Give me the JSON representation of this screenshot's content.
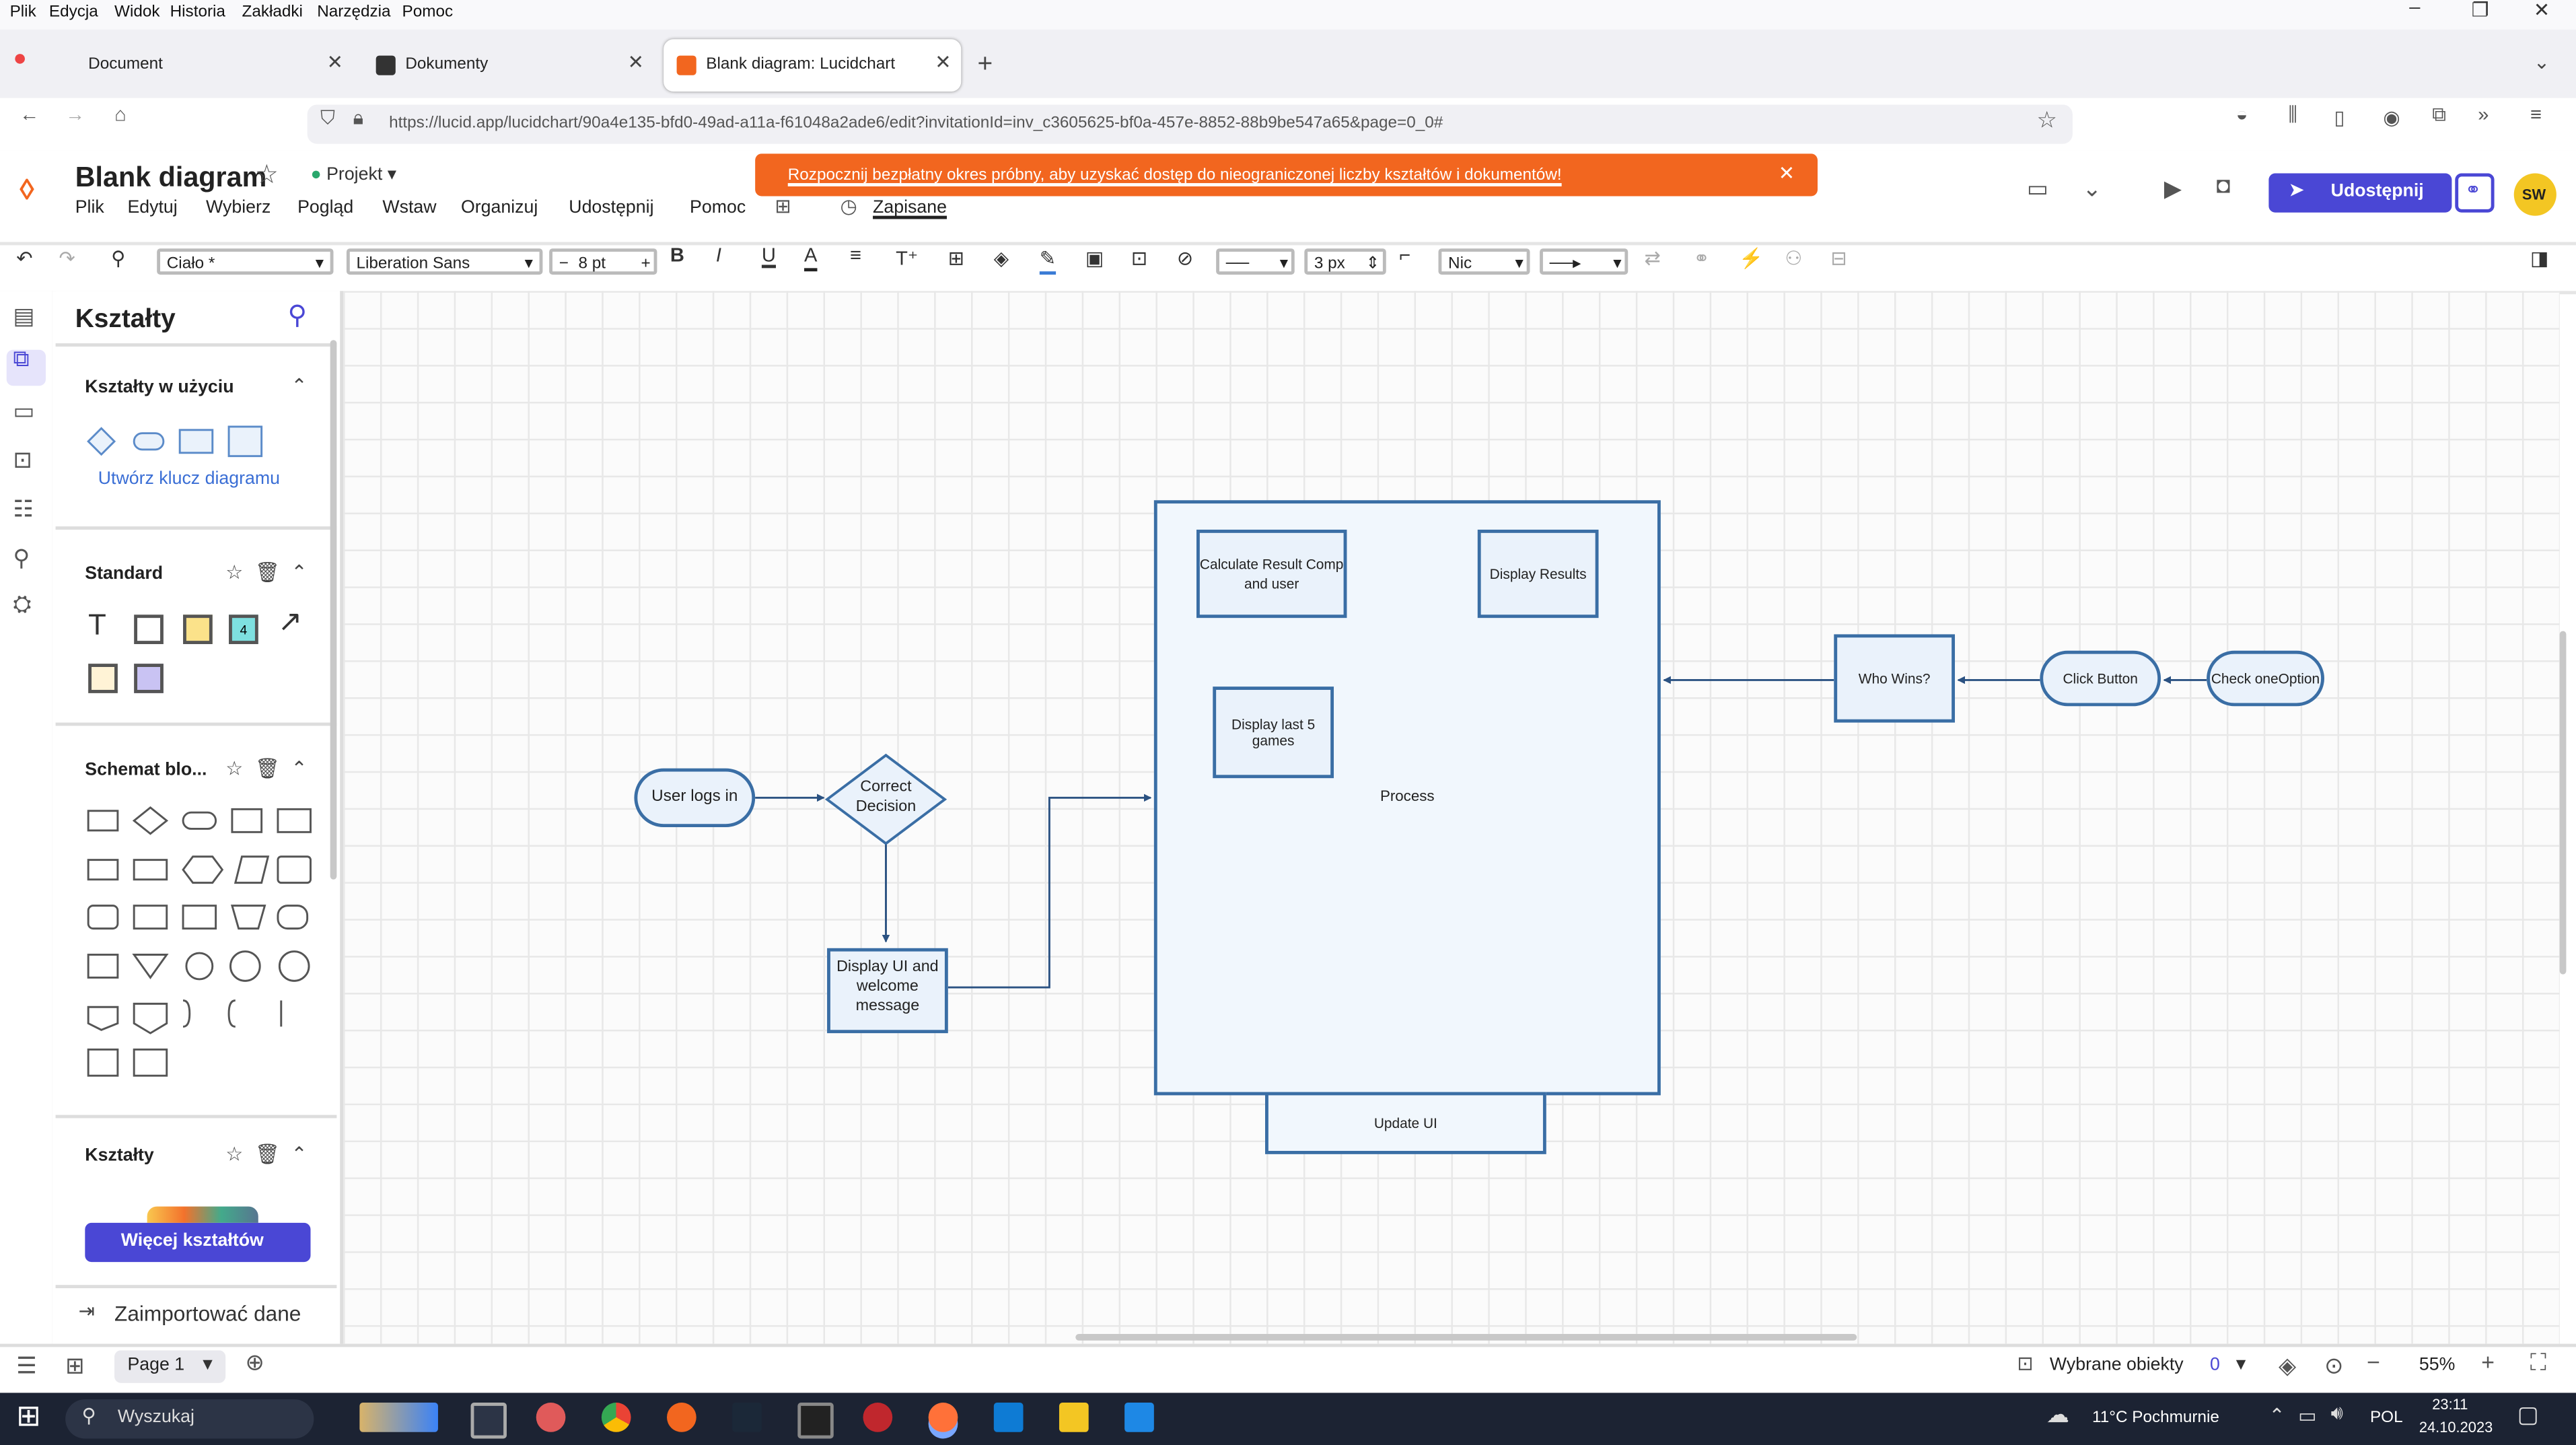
{
  "browser": {
    "menu": [
      "Plik",
      "Edycja",
      "Widok",
      "Historia",
      "Zakładki",
      "Narzędzia",
      "Pomoc"
    ],
    "tabs": [
      {
        "label": "Document"
      },
      {
        "label": "Dokumenty"
      },
      {
        "label": "Blank diagram: Lucidchart"
      }
    ],
    "url_host": "lucid.app",
    "url_full": "https://lucid.app/lucidchart/90a4e135-bfd0-49ad-a11a-f61048a2ade6/edit?invitationId=inv_c3605625-bf0a-457e-8852-88b9be547a65&page=0_0#"
  },
  "app": {
    "doc_title": "Blank diagram",
    "project_label": "Projekt",
    "menus": [
      "Plik",
      "Edytuj",
      "Wybierz",
      "Pogląd",
      "Wstaw",
      "Organizuj",
      "Udostępnij",
      "Pomoc"
    ],
    "saved_label": "Zapisane",
    "banner_text": "Rozpocznij bezpłatny okres próbny, aby uzyskać dostęp do nieograniczonej liczby kształtów i dokumentów!",
    "share_label": "Udostępnij",
    "avatar_initials": "SW"
  },
  "toolbar": {
    "style_select": "Ciało *",
    "font_select": "Liberation Sans",
    "font_size": "8 pt",
    "line_width": "3 px",
    "arrow_start": "Nic"
  },
  "panel": {
    "title": "Kształty",
    "in_use_title": "Kształty w użyciu",
    "create_key_link": "Utwórz klucz diagramu",
    "standard_title": "Standard",
    "flowchart_title": "Schemat blo...",
    "shapes_title": "Kształty",
    "more_shapes_button": "Więcej kształtów",
    "import_label": "Zaimportować dane"
  },
  "diagram": {
    "nodes": {
      "user_logs_in": "User logs in",
      "correct_decision": "Correct Decision",
      "display_ui": "Display UI and welcome message",
      "process": "Process",
      "calculate_result": "Calculate Result Comp and user",
      "display_results": "Display Results",
      "display_last5": "Display last 5 games",
      "update_ui": "Update UI",
      "who_wins": "Who Wins?",
      "click_button": "Click Button",
      "check_one_option": "Check oneOption"
    }
  },
  "bottombar": {
    "page_label": "Page 1",
    "selected_label": "Wybrane obiekty",
    "selected_count": "0",
    "zoom": "55%"
  },
  "taskbar": {
    "search_placeholder": "Wyszukaj",
    "weather": "11°C  Pochmurnie",
    "lang": "POL",
    "time": "23:11",
    "date": "24.10.2023"
  }
}
